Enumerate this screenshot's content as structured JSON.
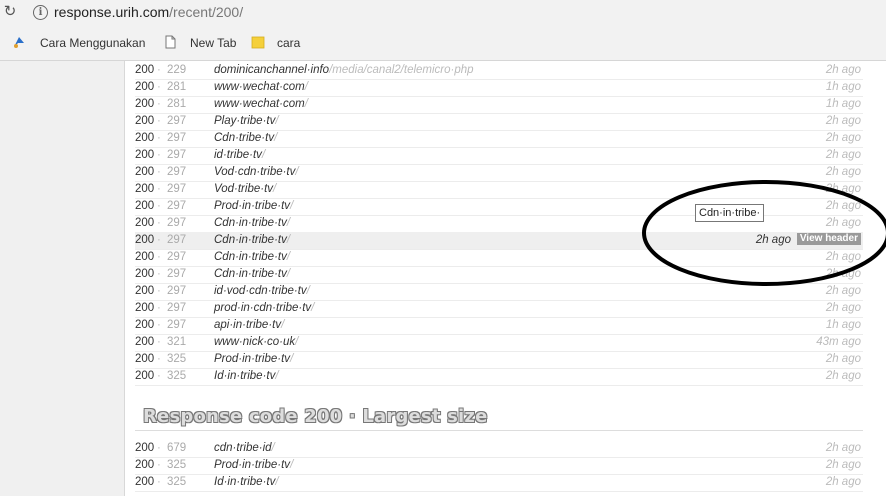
{
  "browser": {
    "url_host": "response.urih.com",
    "url_path": "/recent/200/",
    "bookmarks": [
      "Cara Menggunakan",
      "New Tab",
      "cara"
    ]
  },
  "rows_top": [
    {
      "code": "200",
      "size": "229",
      "host": "dominicanchannel·info",
      "path": "/media/canal2/telemicro·php",
      "time": "2h ago"
    },
    {
      "code": "200",
      "size": "281",
      "host": "www·wechat·com",
      "path": "/",
      "time": "1h ago"
    },
    {
      "code": "200",
      "size": "281",
      "host": "www·wechat·com",
      "path": "/",
      "time": "1h ago"
    },
    {
      "code": "200",
      "size": "297",
      "host": "Play·tribe·tv",
      "path": "/",
      "time": "2h ago"
    },
    {
      "code": "200",
      "size": "297",
      "host": "Cdn·tribe·tv",
      "path": "/",
      "time": "2h ago"
    },
    {
      "code": "200",
      "size": "297",
      "host": "id·tribe·tv",
      "path": "/",
      "time": "2h ago"
    },
    {
      "code": "200",
      "size": "297",
      "host": "Vod·cdn·tribe·tv",
      "path": "/",
      "time": "2h ago"
    },
    {
      "code": "200",
      "size": "297",
      "host": "Vod·tribe·tv",
      "path": "/",
      "time": "2h ago"
    },
    {
      "code": "200",
      "size": "297",
      "host": "Prod·in·tribe·tv",
      "path": "/",
      "time": "2h ago"
    },
    {
      "code": "200",
      "size": "297",
      "host": "Cdn·in·tribe·tv",
      "path": "/",
      "time": "2h ago"
    },
    {
      "code": "200",
      "size": "297",
      "host": "Cdn·in·tribe·tv",
      "path": "/",
      "time": "2h ago",
      "view_header": "View header"
    },
    {
      "code": "200",
      "size": "297",
      "host": "Cdn·in·tribe·tv",
      "path": "/",
      "time": "2h ago"
    },
    {
      "code": "200",
      "size": "297",
      "host": "Cdn·in·tribe·tv",
      "path": "/",
      "time": "2h ago"
    },
    {
      "code": "200",
      "size": "297",
      "host": "id·vod·cdn·tribe·tv",
      "path": "/",
      "time": "2h ago"
    },
    {
      "code": "200",
      "size": "297",
      "host": "prod·in·cdn·tribe·tv",
      "path": "/",
      "time": "2h ago"
    },
    {
      "code": "200",
      "size": "297",
      "host": "api·in·tribe·tv",
      "path": "/",
      "time": "1h ago"
    },
    {
      "code": "200",
      "size": "321",
      "host": "www·nick·co·uk",
      "path": "/",
      "time": "43m ago"
    },
    {
      "code": "200",
      "size": "325",
      "host": "Prod·in·tribe·tv",
      "path": "/",
      "time": "2h ago"
    },
    {
      "code": "200",
      "size": "325",
      "host": "Id·in·tribe·tv",
      "path": "/",
      "time": "2h ago"
    }
  ],
  "section_heading": "Response code 200 · Largest size",
  "rows_bottom": [
    {
      "code": "200",
      "size": "679",
      "host": "cdn·tribe·id",
      "path": "/",
      "time": "2h ago"
    },
    {
      "code": "200",
      "size": "325",
      "host": "Prod·in·tribe·tv",
      "path": "/",
      "time": "2h ago"
    },
    {
      "code": "200",
      "size": "325",
      "host": "Id·in·tribe·tv",
      "path": "/",
      "time": "2h ago"
    }
  ],
  "tooltip": "Cdn·in·tribe·",
  "colors": {
    "annotation": "#000000",
    "badge": "#9a9a9a"
  }
}
